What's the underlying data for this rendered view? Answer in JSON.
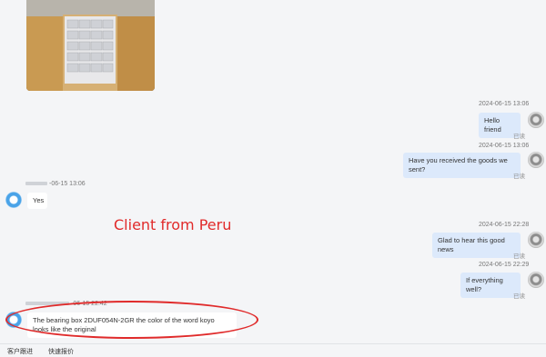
{
  "messages": [
    {
      "side": "out",
      "time": "2024-06-15 13:06",
      "text": "Hello friend",
      "status": "已读"
    },
    {
      "side": "out",
      "time": "2024-06-15 13:06",
      "text": "Have you received the goods we sent?",
      "status": "已读"
    },
    {
      "side": "in",
      "time": "-06-15 13:06",
      "text": "Yes"
    },
    {
      "side": "out",
      "time": "2024-06-15 22:28",
      "text": "Glad to hear this good news",
      "status": "已读"
    },
    {
      "side": "out",
      "time": "2024-06-15 22:29",
      "text": "If everything well?",
      "status": "已读"
    },
    {
      "side": "in",
      "time": "-06-15 22:42",
      "text": "The bearing box 2DUF054N-2GR the color of the word koyo looks like the original"
    }
  ],
  "annotation": "Client from Peru",
  "footer": {
    "tab1": "客户跟进",
    "tab2": "快速报价"
  },
  "colors": {
    "outgoing_bubble": "#dce9fb",
    "annotation": "#e12a2a"
  }
}
